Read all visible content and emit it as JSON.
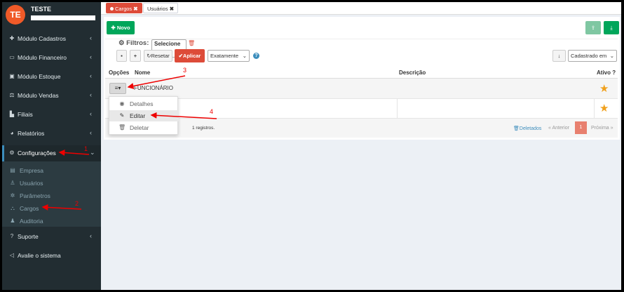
{
  "user": {
    "initials": "TE",
    "name": "TESTE"
  },
  "sidebar": {
    "items": [
      {
        "label": "Módulo Cadastros",
        "icon": "plus-icon"
      },
      {
        "label": "Módulo Financeiro",
        "icon": "money-icon"
      },
      {
        "label": "Módulo Estoque",
        "icon": "box-icon"
      },
      {
        "label": "Módulo Vendas",
        "icon": "balance-icon"
      },
      {
        "label": "Filiais",
        "icon": "chart-icon"
      },
      {
        "label": "Relatórios",
        "icon": "pie-icon"
      },
      {
        "label": "Configurações",
        "icon": "gears-icon"
      }
    ],
    "submenu": [
      {
        "label": "Empresa",
        "icon": "building-icon"
      },
      {
        "label": "Usuários",
        "icon": "user-icon"
      },
      {
        "label": "Parâmetros",
        "icon": "gear-icon"
      },
      {
        "label": "Cargos",
        "icon": "sitemap-icon"
      },
      {
        "label": "Auditoria",
        "icon": "auditor-icon"
      }
    ],
    "bottom": [
      {
        "label": "Suporte",
        "icon": "question-icon"
      },
      {
        "label": "Avalie o sistema",
        "icon": "megaphone-icon"
      }
    ]
  },
  "tabs": [
    {
      "label": "Cargos",
      "active": true
    },
    {
      "label": "Usuários",
      "active": false
    }
  ],
  "toolbar": {
    "novo": "Novo"
  },
  "filters": {
    "title": "Filtros:",
    "select_value": "Selecione",
    "reset": "Resetar",
    "apply": "Aplicar",
    "match_value": "Exatamente",
    "sort_value": "Cadastrado em"
  },
  "table": {
    "headers": {
      "options": "Opções",
      "name": "Nome",
      "description": "Descrição",
      "active": "Ativo ?"
    },
    "rows": [
      {
        "name": "FUNCIONÁRIO",
        "description": "",
        "active": true
      },
      {
        "name": "",
        "description": "",
        "active": true
      }
    ]
  },
  "dropdown": {
    "items": [
      {
        "label": "Detalhes",
        "icon": "eye-icon"
      },
      {
        "label": "Editar",
        "icon": "pencil-icon"
      },
      {
        "label": "Deletar",
        "icon": "trash-icon"
      }
    ]
  },
  "footer": {
    "records_text": "1 registros.",
    "deleted": "Deletados",
    "prev": "« Anterior",
    "page": "1",
    "next": "Próxima »"
  },
  "annotations": {
    "a1": "1",
    "a2": "2",
    "a3": "3",
    "a4": "4"
  },
  "colors": {
    "accent": "#dd4b39",
    "success": "#00a65a",
    "sidebar": "#222d32",
    "annotation": "#e00000"
  }
}
